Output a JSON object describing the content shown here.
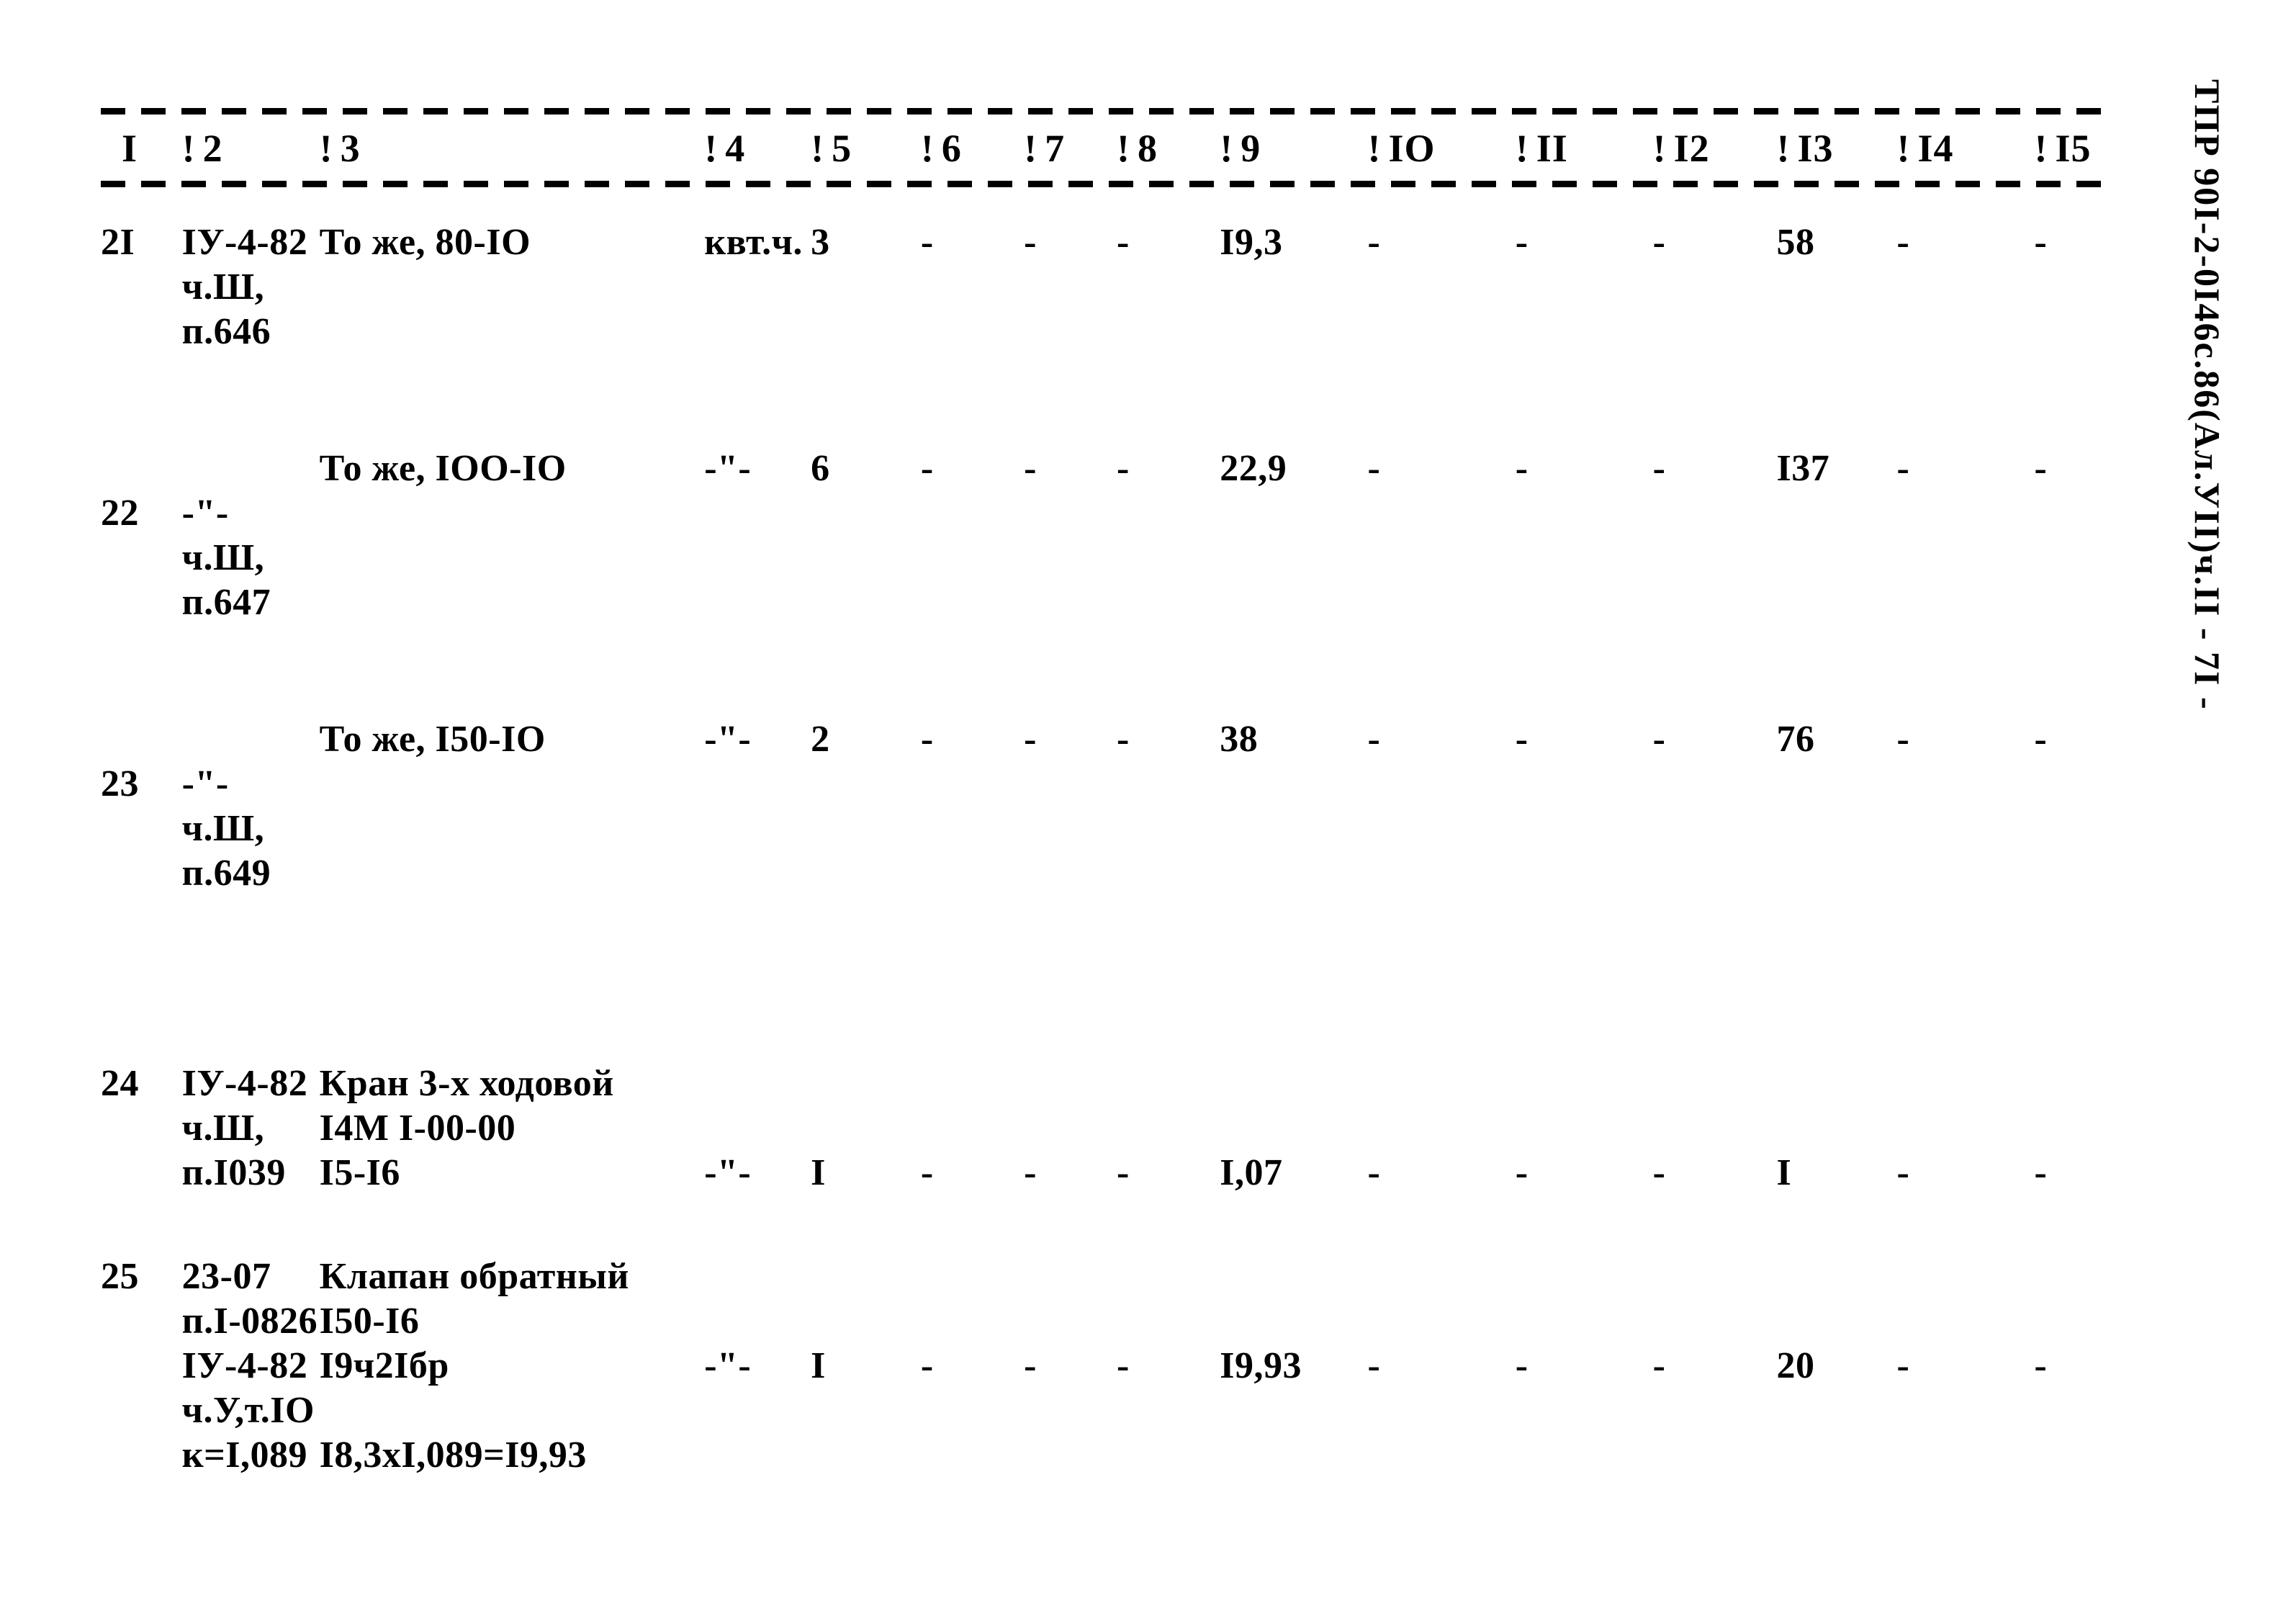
{
  "side_stamp": "ТПР 90I-2-0I46с.86(Ал.УII)ч.II - 7I -",
  "table": {
    "column_headers": [
      "I",
      "2",
      "3",
      "4",
      "5",
      "6",
      "7",
      "8",
      "9",
      "IO",
      "II",
      "I2",
      "I3",
      "I4",
      "I5"
    ],
    "separator": "!",
    "rows": [
      {
        "num": "2I",
        "code": "ІУ-4-82\nч.Ш,\nп.646",
        "name": "То же, 80-IO",
        "unit": "квт.ч.",
        "qty": "3",
        "c6": "-",
        "c7": "-",
        "c8": "-",
        "c9": "I9,3",
        "c10": "-",
        "c11": "-",
        "c12": "-",
        "c13": "58",
        "c14": "-",
        "c15": "-"
      },
      {
        "num": "22",
        "code": "-\"-\nч.Ш,\nп.647",
        "name": "То же, IOO-IO",
        "unit": "-\"-",
        "qty": "6",
        "c6": "-",
        "c7": "-",
        "c8": "-",
        "c9": "22,9",
        "c10": "-",
        "c11": "-",
        "c12": "-",
        "c13": "I37",
        "c14": "-",
        "c15": "-"
      },
      {
        "num": "23",
        "code": "-\"-\nч.Ш,\nп.649",
        "name": "То же, I50-IO",
        "unit": "-\"-",
        "qty": "2",
        "c6": "-",
        "c7": "-",
        "c8": "-",
        "c9": "38",
        "c10": "-",
        "c11": "-",
        "c12": "-",
        "c13": "76",
        "c14": "-",
        "c15": "-"
      },
      {
        "num": "24",
        "code": "ІУ-4-82\nч.Ш,\nп.I039",
        "name": "Кран 3-х ходовой\nI4М I-00-00\nI5-I6",
        "unit": "-\"-",
        "qty": "I",
        "c6": "-",
        "c7": "-",
        "c8": "-",
        "c9": "I,07",
        "c10": "-",
        "c11": "-",
        "c12": "-",
        "c13": "I",
        "c14": "-",
        "c15": "-"
      },
      {
        "num": "25",
        "code": "23-07\nп.I-0826\nІУ-4-82\nч.У,т.IO\nк=I,089",
        "name": "Клапан обратный\nI50-I6\nI9ч2Iбр\n\nI8,3хI,089=I9,93",
        "unit": "-\"-",
        "qty": "I",
        "c6": "-",
        "c7": "-",
        "c8": "-",
        "c9": "I9,93",
        "c10": "-",
        "c11": "-",
        "c12": "-",
        "c13": "20",
        "c14": "-",
        "c15": "-"
      }
    ]
  }
}
